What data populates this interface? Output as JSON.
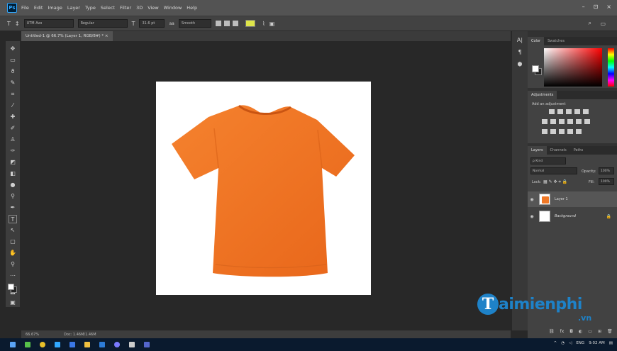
{
  "menu": [
    "File",
    "Edit",
    "Image",
    "Layer",
    "Type",
    "Select",
    "Filter",
    "3D",
    "View",
    "Window",
    "Help"
  ],
  "window_controls": [
    "–",
    "⊡",
    "×"
  ],
  "options": {
    "font_family": "UTM Avo",
    "font_style": "Regular",
    "font_size": "31.6 pt",
    "aa_label": "aa",
    "antialias": "Smooth",
    "color_swatch": "#dfe64a"
  },
  "document_tab": "Untitled-1 @ 66.7% (Layer 1, RGB/8#) * ×",
  "statusbar": {
    "zoom": "66.67%",
    "doc_info": "Doc: 1.46M/1.46M"
  },
  "panels": {
    "color_tabs": [
      "Color",
      "Swatches"
    ],
    "adjustments_title": "Adjustments",
    "adjustments_add": "Add an adjustment",
    "layers_tabs": [
      "Layers",
      "Channels",
      "Paths"
    ],
    "kind_filter": "ρ Kind",
    "blend_mode": "Normal",
    "opacity_label": "Opacity:",
    "opacity_value": "100%",
    "lock_label": "Lock:",
    "fill_label": "Fill:",
    "fill_value": "100%",
    "layers": [
      {
        "name": "Layer 1"
      },
      {
        "name": "Background"
      }
    ]
  },
  "watermark": {
    "letter": "T",
    "text": "aimienphi",
    "suffix": ".vn"
  },
  "taskbar": {
    "tray": [
      "^",
      "ENG",
      "9:02 AM"
    ]
  }
}
